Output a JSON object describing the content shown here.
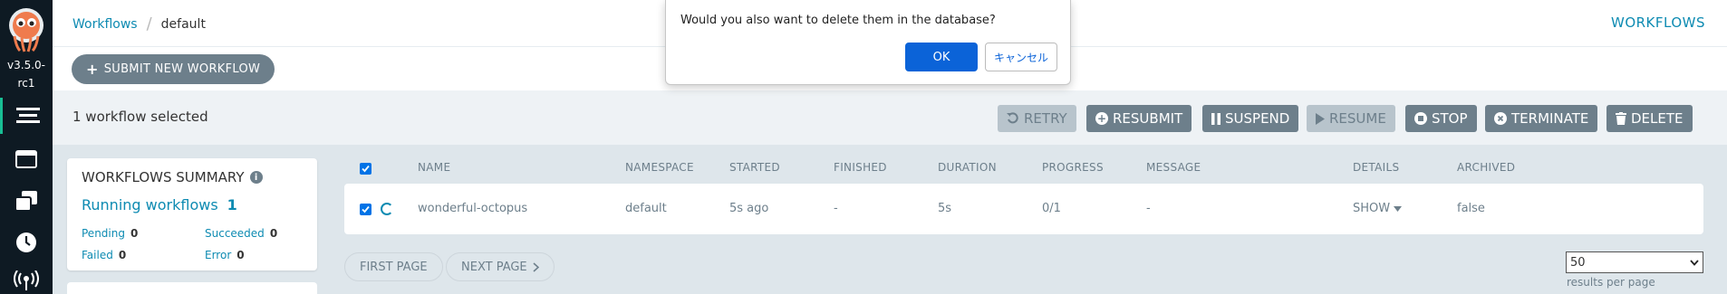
{
  "app": {
    "version": "v3.5.0-rc1"
  },
  "breadcrumb": {
    "root": "Workflows",
    "current": "default"
  },
  "header": {
    "title": "WORKFLOWS"
  },
  "actions": {
    "submit_label": "SUBMIT NEW WORKFLOW"
  },
  "toolbar": {
    "selected_text": "1 workflow selected",
    "buttons": [
      {
        "label": "RETRY",
        "icon": "retry-icon",
        "enabled": false
      },
      {
        "label": "RESUBMIT",
        "icon": "plus-circle-icon",
        "enabled": true
      },
      {
        "label": "SUSPEND",
        "icon": "pause-icon",
        "enabled": true
      },
      {
        "label": "RESUME",
        "icon": "play-icon",
        "enabled": false
      },
      {
        "label": "STOP",
        "icon": "stop-circle-icon",
        "enabled": true
      },
      {
        "label": "TERMINATE",
        "icon": "times-circle-icon",
        "enabled": true
      },
      {
        "label": "DELETE",
        "icon": "trash-icon",
        "enabled": true
      }
    ]
  },
  "summary": {
    "title": "WORKFLOWS SUMMARY",
    "running_label": "Running workflows",
    "running_count": "1",
    "pending_label": "Pending",
    "pending": "0",
    "succeeded_label": "Succeeded",
    "succeeded": "0",
    "failed_label": "Failed",
    "failed": "0",
    "error_label": "Error",
    "error": "0"
  },
  "table": {
    "headers": [
      "NAME",
      "NAMESPACE",
      "STARTED",
      "FINISHED",
      "DURATION",
      "PROGRESS",
      "MESSAGE",
      "DETAILS",
      "ARCHIVED"
    ],
    "rows": [
      {
        "name": "wonderful-octopus",
        "namespace": "default",
        "started": "5s ago",
        "finished": "-",
        "duration": "5s",
        "progress": "0/1",
        "message": "-",
        "details": "SHOW",
        "archived": "false",
        "selected": true
      }
    ]
  },
  "pagination": {
    "first": "FIRST PAGE",
    "next": "NEXT PAGE",
    "per_page_value": "50",
    "per_page_label": "results per page"
  },
  "dialog": {
    "message": "Would you also want to delete them in the database?",
    "ok": "OK",
    "cancel": "キャンセル"
  },
  "colors": {
    "accent": "#0e8bb2",
    "sidebar": "#0e1a23",
    "button": "#6d7f8b",
    "dialog_ok": "#0b63d8"
  }
}
